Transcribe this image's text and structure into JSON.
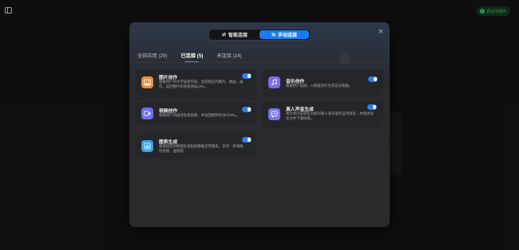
{
  "background": {
    "status_badge": "调试中插件"
  },
  "mode_switch": {
    "smart_label": "智能连接",
    "manual_label": "手动连接",
    "active": "manual"
  },
  "tabs": [
    {
      "label": "全部应用 (29)",
      "active": false
    },
    {
      "label": "已连接 (5)",
      "active": true
    },
    {
      "label": "未连接 (24)",
      "active": false
    }
  ],
  "cards": [
    {
      "title": "图片创作",
      "desc": "根据用户的文字描述内容，生成相应的图片。图画、画作，返回图片的查看地址URL。",
      "enabled": true,
      "icon": "image-icon",
      "icon_color": "#f08a3a"
    },
    {
      "title": "音乐创作",
      "desc": "根据用户描述，AI智能创作生成音乐歌曲。",
      "enabled": true,
      "icon": "music-note-icon",
      "icon_color": "#7b6cf0"
    },
    {
      "title": "视频创作",
      "desc": "根据用户的描述生成视频，并返回视频的访问URL。",
      "enabled": true,
      "icon": "video-icon",
      "icon_color": "#6e6ef0"
    },
    {
      "title": "真人声音生成",
      "desc": "将文本内容转化为如同真人发声般的自然语音，并提供语音文件下载链接。",
      "enabled": true,
      "icon": "chat-bubble-icon",
      "icon_color": "#7b74f0"
    },
    {
      "title": "图表生成",
      "desc": "根据指定的数据生成相关数据走势图表。支持：折线图、柱状图、面积图",
      "enabled": true,
      "icon": "chart-icon",
      "icon_color": "#3aa0e8"
    }
  ]
}
